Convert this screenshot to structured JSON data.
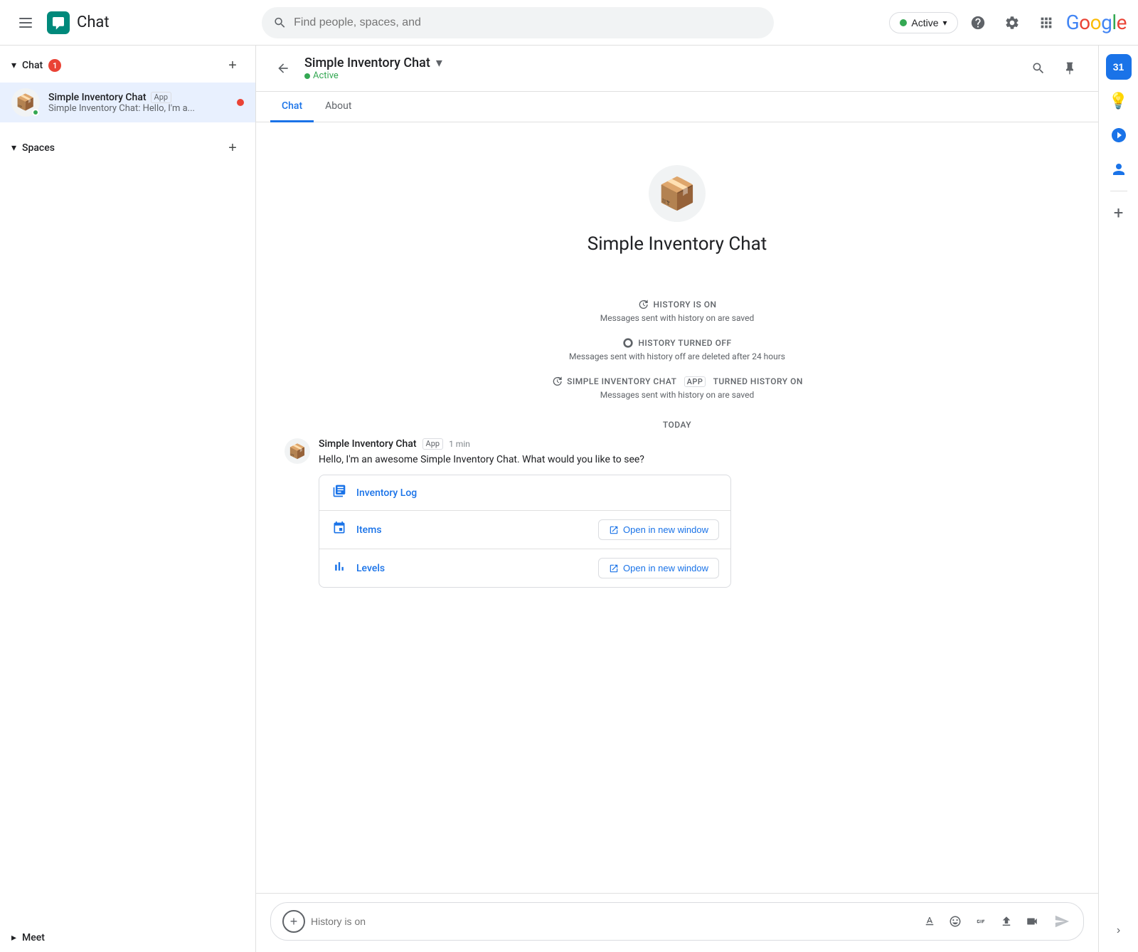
{
  "topbar": {
    "title": "Chat",
    "search_placeholder": "Find people, spaces, and",
    "active_label": "Active",
    "google_label": "Google"
  },
  "sidebar": {
    "chat_section": {
      "label": "Chat",
      "badge": "1",
      "add_label": "+"
    },
    "chat_items": [
      {
        "name": "Simple Inventory Chat",
        "app_badge": "App",
        "preview": "Simple Inventory Chat: Hello, I'm a...",
        "has_online": true,
        "has_unread": true,
        "emoji": "📦"
      }
    ],
    "spaces_section": {
      "label": "Spaces",
      "add_label": "+"
    },
    "meet_section": {
      "label": "Meet"
    }
  },
  "chat": {
    "header_name": "Simple Inventory Chat",
    "header_status": "Active",
    "back_label": "←",
    "tab_chat": "Chat",
    "tab_about": "About"
  },
  "bot_intro": {
    "name": "Simple Inventory Chat",
    "emoji": "📦"
  },
  "history_notices": [
    {
      "icon": "🕐",
      "label": "HISTORY IS ON",
      "sub": "Messages sent with history on are saved"
    },
    {
      "icon": "🕐",
      "label": "HISTORY TURNED OFF",
      "sub": "Messages sent with history off are deleted after 24 hours"
    },
    {
      "icon": "🕐",
      "label_prefix": "SIMPLE INVENTORY CHAT",
      "label_app": "APP",
      "label_suffix": "TURNED HISTORY ON",
      "sub": "Messages sent with history on are saved"
    }
  ],
  "today_label": "TODAY",
  "message": {
    "sender": "Simple Inventory Chat",
    "app_badge": "App",
    "time": "1 min",
    "text": "Hello, I'm an awesome  Simple Inventory Chat. What would you like to see?",
    "emoji": "📦"
  },
  "action_card": {
    "items": [
      {
        "icon": "📊",
        "label": "Inventory Log",
        "has_button": false
      },
      {
        "icon": "🔷",
        "label": "Items",
        "has_button": true,
        "button_label": "Open in new window"
      },
      {
        "icon": "📈",
        "label": "Levels",
        "has_button": true,
        "button_label": "Open in new window"
      }
    ]
  },
  "message_input": {
    "placeholder": "History is on"
  },
  "right_panel": {
    "calendar_day": "31",
    "add_label": "+"
  }
}
